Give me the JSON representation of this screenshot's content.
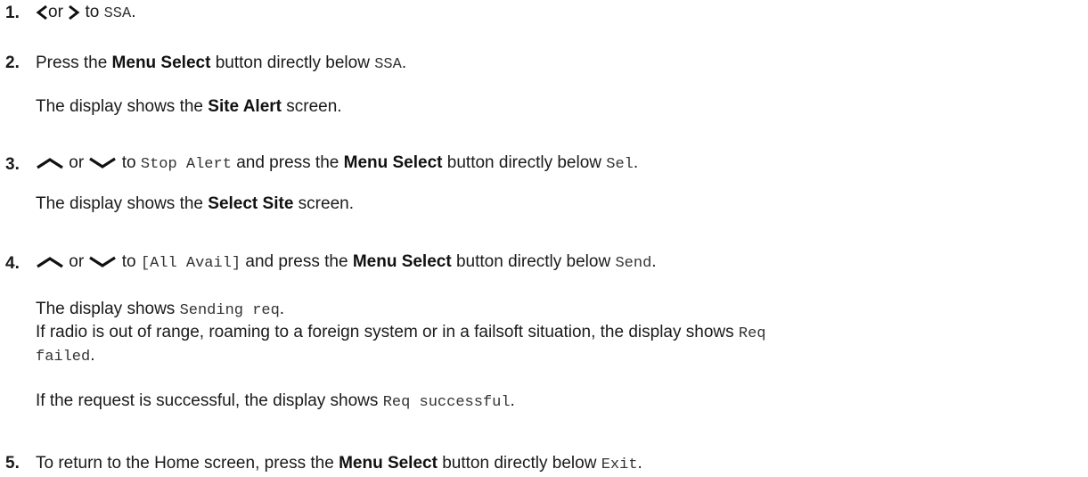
{
  "steps": [
    {
      "number": "1.",
      "icon_left": "chevron-left-icon",
      "or": "or",
      "icon_right": "chevron-right-icon",
      "to": "to",
      "target": "SSA",
      "end": "."
    },
    {
      "number": "2.",
      "text_a": "Press the",
      "bold": "Menu Select",
      "text_b": "button directly below",
      "mono": "SSA",
      "end": ".",
      "result_a": "The display shows the",
      "result_bold": "Site Alert",
      "result_b": "screen."
    },
    {
      "number": "3.",
      "icon_up": "chevron-up-icon",
      "or": "or",
      "icon_down": "chevron-down-icon",
      "to": "to",
      "target": "Stop Alert",
      "text_a": "and press the",
      "bold": "Menu Select",
      "text_b": "button directly below",
      "mono": "Sel",
      "end": ".",
      "result_a": "The display shows the",
      "result_bold": "Select Site",
      "result_b": "screen."
    },
    {
      "number": "4.",
      "icon_up": "chevron-up-icon",
      "or": "or",
      "icon_down": "chevron-down-icon",
      "to": "to",
      "target": "[All Avail]",
      "text_a": "and press the",
      "bold": "Menu Select",
      "text_b": "button directly below",
      "mono": "Send",
      "end": ".",
      "r1_a": "The display shows",
      "r1_mono": "Sending req",
      "r1_end": ".",
      "r2_a": "If radio is out of range, roaming to a foreign system or in a failsoft situation, the display shows",
      "r2_mono1": "Req",
      "r2_mono2": "failed",
      "r2_end": ".",
      "r3_a": "If the request is successful, the display shows",
      "r3_mono": "Req successful",
      "r3_end": "."
    },
    {
      "number": "5.",
      "text_a": "To return to the Home screen, press the",
      "bold": "Menu Select",
      "text_b": "button directly below",
      "mono": "Exit",
      "end": "."
    }
  ]
}
